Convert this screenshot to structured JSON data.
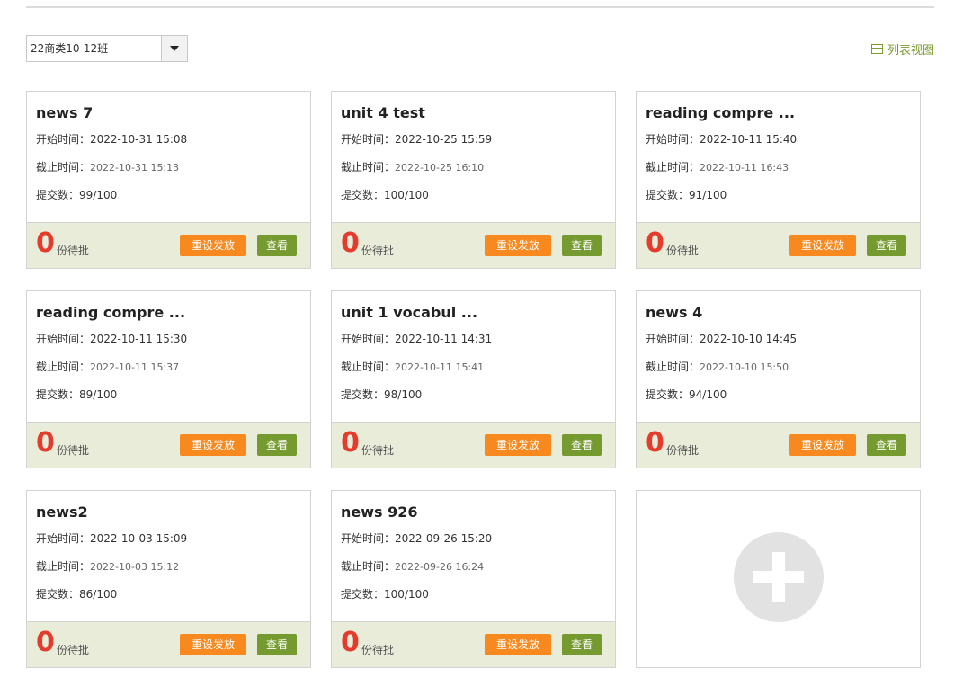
{
  "toolbar": {
    "class_selected": "22商类10-12班",
    "list_view_label": "列表视图"
  },
  "labels": {
    "start": "开始时间：",
    "end": "截止时间：",
    "submitted": "提交数：",
    "pending_suffix": "份待批",
    "reset_button": "重设发放",
    "view_button": "查看"
  },
  "cards": [
    {
      "title": "news 7",
      "start": "2022-10-31 15:08",
      "end": "2022-10-31 15:13",
      "submitted": "99/100",
      "pending": "0"
    },
    {
      "title": "unit 4 test",
      "start": "2022-10-25 15:59",
      "end": "2022-10-25 16:10",
      "submitted": "100/100",
      "pending": "0"
    },
    {
      "title": "reading compre ...",
      "start": "2022-10-11 15:40",
      "end": "2022-10-11 16:43",
      "submitted": "91/100",
      "pending": "0"
    },
    {
      "title": "reading compre ...",
      "start": "2022-10-11 15:30",
      "end": "2022-10-11 15:37",
      "submitted": "89/100",
      "pending": "0"
    },
    {
      "title": "unit 1 vocabul ...",
      "start": "2022-10-11 14:31",
      "end": "2022-10-11 15:41",
      "submitted": "98/100",
      "pending": "0"
    },
    {
      "title": "news 4",
      "start": "2022-10-10 14:45",
      "end": "2022-10-10 15:50",
      "submitted": "94/100",
      "pending": "0"
    },
    {
      "title": "news2",
      "start": "2022-10-03 15:09",
      "end": "2022-10-03 15:12",
      "submitted": "86/100",
      "pending": "0"
    },
    {
      "title": "news 926",
      "start": "2022-09-26 15:20",
      "end": "2022-09-26 16:24",
      "submitted": "100/100",
      "pending": "0"
    }
  ],
  "colors": {
    "accent_green": "#759a2f",
    "accent_orange": "#f7891f",
    "pending_red": "#e53b2c",
    "footer_bg": "#e8ecd9"
  }
}
